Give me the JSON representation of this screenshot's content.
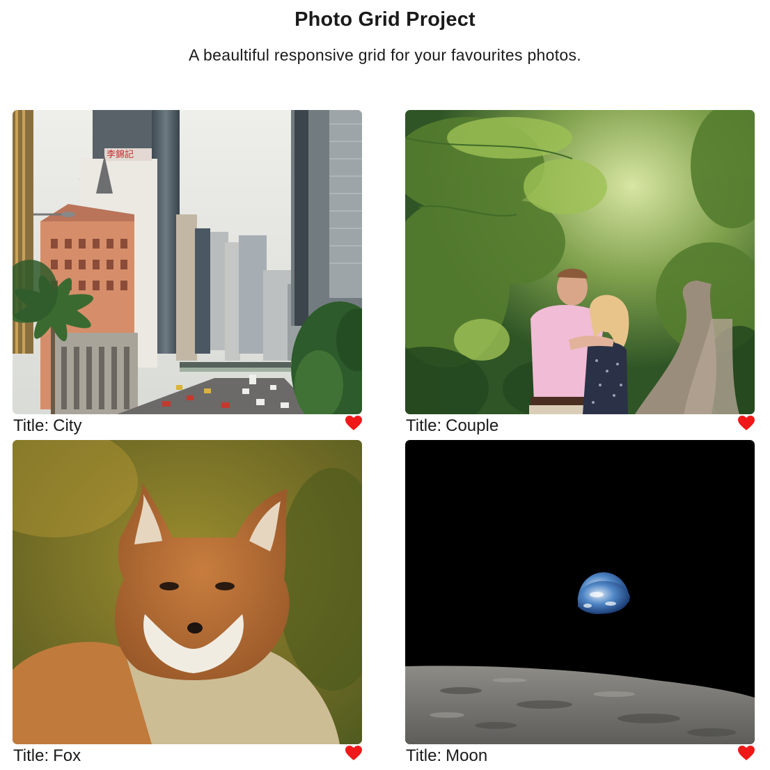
{
  "header": {
    "title": "Photo Grid Project",
    "subtitle": "A beaultiful responsive grid for your favourites photos."
  },
  "photos": [
    {
      "title_prefix": "Title:",
      "title": "City",
      "image": "city-street-skyscrapers",
      "favorite": true
    },
    {
      "title_prefix": "Title:",
      "title": "Couple",
      "image": "couple-forest-path",
      "favorite": true
    },
    {
      "title_prefix": "Title:",
      "title": "Fox",
      "image": "red-fox-portrait",
      "favorite": true
    },
    {
      "title_prefix": "Title:",
      "title": "Moon",
      "image": "earthrise-over-moon",
      "favorite": true
    }
  ],
  "colors": {
    "heart": "#f01818",
    "text": "#1a1a1a"
  },
  "icons": {
    "favorite": "heart-icon"
  }
}
